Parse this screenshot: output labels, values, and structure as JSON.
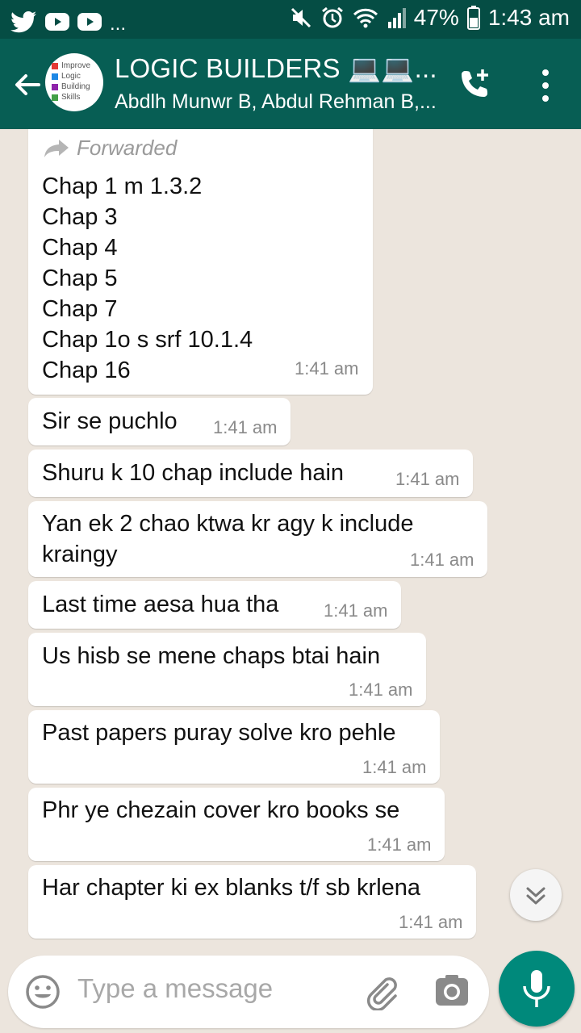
{
  "status_bar": {
    "dots": "...",
    "battery": "47%",
    "time": "1:43 am"
  },
  "header": {
    "title": "LOGIC BUILDERS 💻💻...",
    "subtitle": "Abdlh Munwr B, Abdul Rehman B,...",
    "avatar_lines": [
      "Improve",
      "Logic",
      "Building",
      "Skills"
    ]
  },
  "messages": [
    {
      "forwarded_label": "Forwarded",
      "lines": [
        "Chap 1 m 1.3.2",
        "Chap 3",
        "Chap 4",
        "Chap 5",
        "Chap 7",
        "Chap 1o s srf 10.1.4",
        "Chap 16"
      ],
      "time": "1:41 am"
    },
    {
      "lines": [
        "Sir se puchlo"
      ],
      "time": "1:41 am"
    },
    {
      "lines": [
        "Shuru k 10 chap include hain"
      ],
      "time": "1:41 am"
    },
    {
      "lines": [
        "Yan ek 2 chao ktwa kr agy k include",
        "kraingy"
      ],
      "time": "1:41 am"
    },
    {
      "lines": [
        "Last time aesa hua tha"
      ],
      "time": "1:41 am"
    },
    {
      "lines": [
        "Us hisb se mene chaps btai hain"
      ],
      "time": "1:41 am"
    },
    {
      "lines": [
        "Past papers puray solve kro pehle"
      ],
      "time": "1:41 am"
    },
    {
      "lines": [
        "Phr ye chezain cover kro books se"
      ],
      "time": "1:41 am"
    },
    {
      "lines": [
        "Har chapter ki ex blanks t/f sb krlena"
      ],
      "time": "1:41 am"
    }
  ],
  "input": {
    "placeholder": "Type a message"
  },
  "colors": {
    "status_bar": "#054D44",
    "app_bar": "#075E54",
    "chat_background": "#ECE5DD",
    "mic_button": "#00897B"
  }
}
